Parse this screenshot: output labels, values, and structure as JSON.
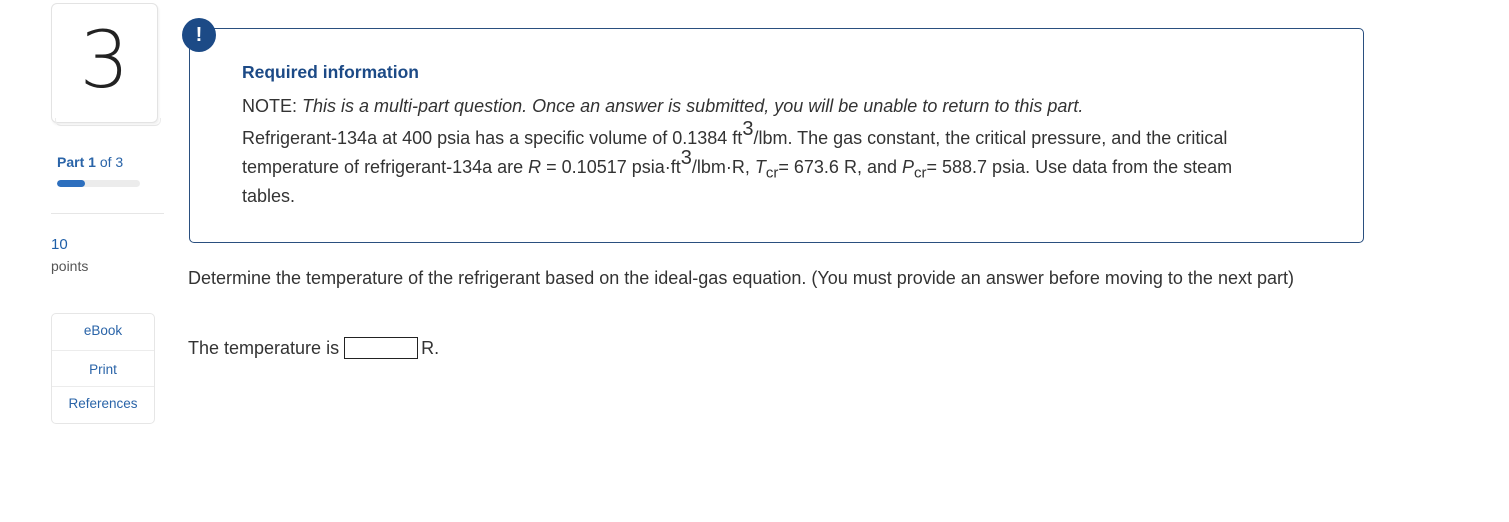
{
  "question": {
    "number": "3",
    "part_current": "1",
    "part_total": "3",
    "part_word": "Part",
    "part_of": "of",
    "progress_fraction": 0.333,
    "points_value": "10",
    "points_label": "points"
  },
  "resources": {
    "ebook": "eBook",
    "print": "Print",
    "references": "References"
  },
  "info": {
    "icon_symbol": "!",
    "title": "Required information",
    "note_prefix": "NOTE: ",
    "note_text": "This is a multi-part question. Once an answer is submitted, you will be unable to return to this part.",
    "line1_a": "Refrigerant-134a at 400 psia has a specific volume of 0.1384 ft",
    "line1_sup": "3",
    "line1_b": "/lbm. The gas constant, the critical pressure, and the critical",
    "line2_a": "temperature of refrigerant-134a are ",
    "line2_R": "R",
    "line2_b": " = 0.10517 psia·ft",
    "line2_sup": "3",
    "line2_c": "/lbm·R, ",
    "line2_T": "T",
    "line2_Tsub": "cr",
    "line2_d": "= 673.6 R, and ",
    "line2_P": "P",
    "line2_Psub": "cr",
    "line2_e": "= 588.7 psia. Use data from the steam",
    "line3": "tables."
  },
  "main": {
    "prompt": "Determine the temperature of the refrigerant based on the ideal-gas equation. (You must provide an answer before moving to the next part)",
    "answer_prefix": "The temperature is",
    "answer_value": "",
    "answer_unit": "R."
  },
  "colors": {
    "accent": "#1c4a86",
    "link": "#2a64a8",
    "progress": "#2d6fbe"
  }
}
